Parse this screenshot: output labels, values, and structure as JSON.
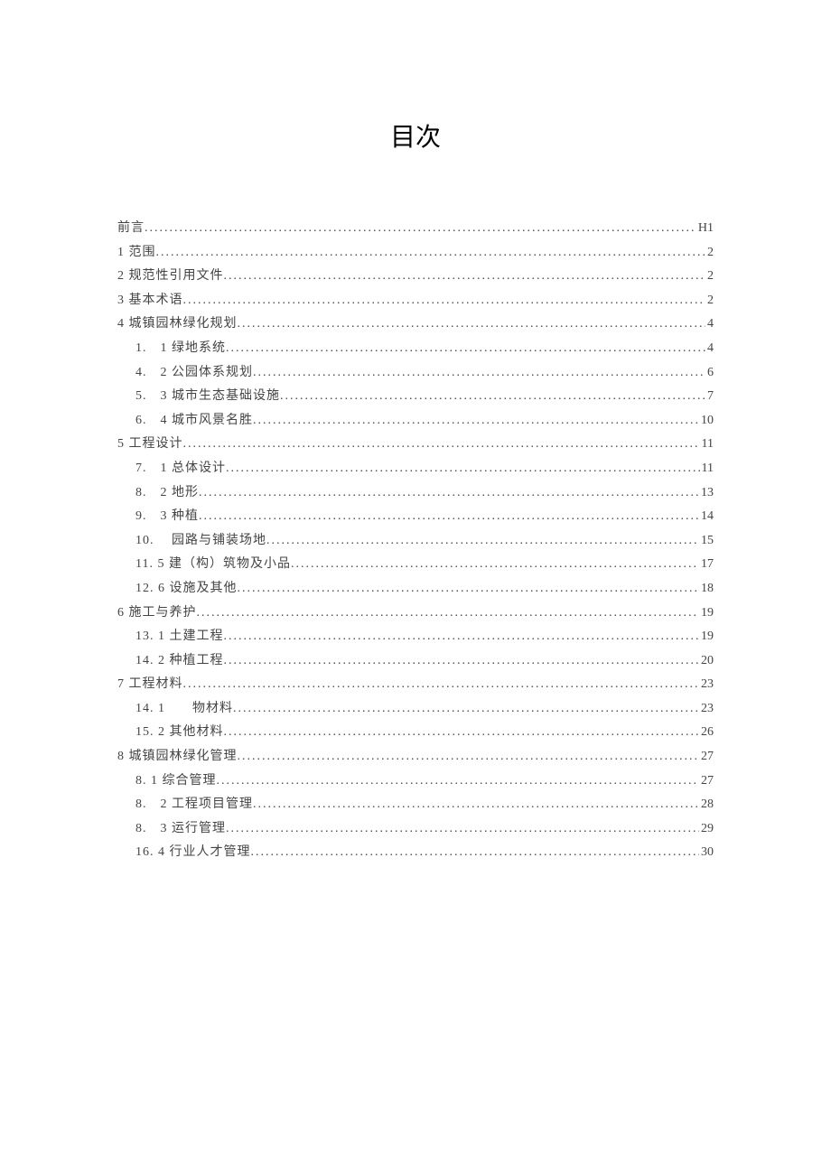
{
  "title": "目次",
  "toc": [
    {
      "level": 1,
      "label": "前言",
      "page": "H1"
    },
    {
      "level": 1,
      "label": "1 范围",
      "page": "2"
    },
    {
      "level": 1,
      "label": "2 规范性引用文件",
      "page": "2"
    },
    {
      "level": 1,
      "label": "3 基本术语",
      "page": "2"
    },
    {
      "level": 1,
      "label": "4 城镇园林绿化规划",
      "page": "4"
    },
    {
      "level": 2,
      "label": "1.　1 绿地系统",
      "page": "4"
    },
    {
      "level": 2,
      "label": "4.　2 公园体系规划",
      "page": "6"
    },
    {
      "level": 2,
      "label": "5.　3 城市生态基础设施",
      "page": "7"
    },
    {
      "level": 2,
      "label": "6.　4 城市风景名胜",
      "page": "10"
    },
    {
      "level": 1,
      "label": "5 工程设计",
      "page": "11"
    },
    {
      "level": 2,
      "label": "7.　1 总体设计",
      "page": "11"
    },
    {
      "level": 2,
      "label": "8.　2 地形",
      "page": "13"
    },
    {
      "level": 2,
      "label": "9.　3 种植",
      "page": "14"
    },
    {
      "level": 2,
      "label": "10.　 园路与铺装场地",
      "page": "15"
    },
    {
      "level": 2,
      "label": "11. 5 建（构）筑物及小品",
      "page": "17"
    },
    {
      "level": 2,
      "label": "12. 6 设施及其他",
      "page": "18"
    },
    {
      "level": 1,
      "label": "6 施工与养护",
      "page": "19"
    },
    {
      "level": 2,
      "label": "13. 1 土建工程",
      "page": "19"
    },
    {
      "level": 2,
      "label": "14. 2 种植工程",
      "page": "20"
    },
    {
      "level": 1,
      "label": "7 工程材料",
      "page": "23"
    },
    {
      "level": 2,
      "label": "14. 1　　物材料",
      "page": "23"
    },
    {
      "level": 2,
      "label": "15. 2 其他材料",
      "page": "26"
    },
    {
      "level": 1,
      "label": "8 城镇园林绿化管理",
      "page": "27"
    },
    {
      "level": 2,
      "label": "8. 1 综合管理",
      "page": "27"
    },
    {
      "level": 2,
      "label": "8.　2 工程项目管理",
      "page": "28"
    },
    {
      "level": 2,
      "label": "8.　3 运行管理",
      "page": "29"
    },
    {
      "level": 2,
      "label": "16. 4 行业人才管理",
      "page": "30"
    }
  ]
}
